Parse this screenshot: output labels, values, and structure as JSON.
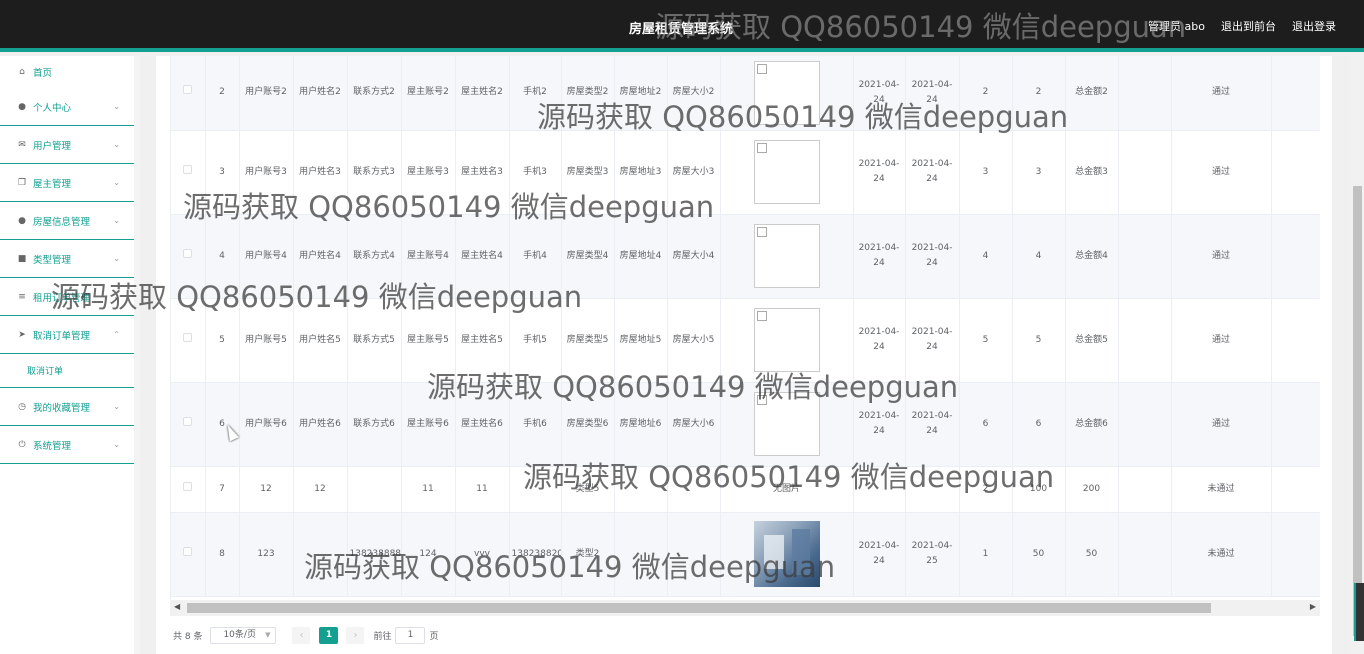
{
  "header": {
    "title": "房屋租赁管理系统",
    "user_label": "管理员 abo",
    "front_link": "退出到前台",
    "logout_link": "退出登录"
  },
  "sidebar": {
    "items": [
      {
        "label": "首页",
        "icon": "home-icon"
      },
      {
        "label": "个人中心",
        "icon": "user-icon"
      },
      {
        "label": "用户管理",
        "icon": "mail-icon"
      },
      {
        "label": "屋主管理",
        "icon": "copy-icon"
      },
      {
        "label": "房屋信息管理",
        "icon": "user-icon"
      },
      {
        "label": "类型管理",
        "icon": "briefcase-icon"
      },
      {
        "label": "租用订单管理",
        "icon": "sliders-icon"
      },
      {
        "label": "取消订单管理",
        "icon": "send-icon"
      },
      {
        "label": "我的收藏管理",
        "icon": "clock-icon"
      },
      {
        "label": "系统管理",
        "icon": "power-icon"
      }
    ],
    "submenu_label": "取消订单"
  },
  "table": {
    "rows": [
      {
        "id": "2",
        "c1": "用户账号2",
        "c2": "用户姓名2",
        "c3": "联系方式2",
        "c4": "屋主账号2",
        "c5": "屋主姓名2",
        "c6": "手机2",
        "c7": "房屋类型2",
        "c8": "房屋地址2",
        "c9": "房屋大小2",
        "img": "broken",
        "d1": "2021-04-24",
        "d2": "2021-04-24",
        "n1": "2",
        "n2": "2",
        "total": "总金额2",
        "status": "通过"
      },
      {
        "id": "3",
        "c1": "用户账号3",
        "c2": "用户姓名3",
        "c3": "联系方式3",
        "c4": "屋主账号3",
        "c5": "屋主姓名3",
        "c6": "手机3",
        "c7": "房屋类型3",
        "c8": "房屋地址3",
        "c9": "房屋大小3",
        "img": "broken",
        "d1": "2021-04-24",
        "d2": "2021-04-24",
        "n1": "3",
        "n2": "3",
        "total": "总金额3",
        "status": "通过"
      },
      {
        "id": "4",
        "c1": "用户账号4",
        "c2": "用户姓名4",
        "c3": "联系方式4",
        "c4": "屋主账号4",
        "c5": "屋主姓名4",
        "c6": "手机4",
        "c7": "房屋类型4",
        "c8": "房屋地址4",
        "c9": "房屋大小4",
        "img": "broken",
        "d1": "2021-04-24",
        "d2": "2021-04-24",
        "n1": "4",
        "n2": "4",
        "total": "总金额4",
        "status": "通过"
      },
      {
        "id": "5",
        "c1": "用户账号5",
        "c2": "用户姓名5",
        "c3": "联系方式5",
        "c4": "屋主账号5",
        "c5": "屋主姓名5",
        "c6": "手机5",
        "c7": "房屋类型5",
        "c8": "房屋地址5",
        "c9": "房屋大小5",
        "img": "broken",
        "d1": "2021-04-24",
        "d2": "2021-04-24",
        "n1": "5",
        "n2": "5",
        "total": "总金额5",
        "status": "通过"
      },
      {
        "id": "6",
        "c1": "用户账号6",
        "c2": "用户姓名6",
        "c3": "联系方式6",
        "c4": "屋主账号6",
        "c5": "屋主姓名6",
        "c6": "手机6",
        "c7": "房屋类型6",
        "c8": "房屋地址6",
        "c9": "房屋大小6",
        "img": "broken",
        "d1": "2021-04-24",
        "d2": "2021-04-24",
        "n1": "6",
        "n2": "6",
        "total": "总金额6",
        "status": "通过"
      },
      {
        "id": "7",
        "c1": "12",
        "c2": "12",
        "c3": "",
        "c4": "11",
        "c5": "11",
        "c6": "",
        "c7": "类型5",
        "c8": "",
        "c9": "",
        "img": "text",
        "img_text": "无图片",
        "d1": "",
        "d2": "",
        "n1": "2",
        "n2": "100",
        "total": "200",
        "status": "未通过"
      },
      {
        "id": "8",
        "c1": "123",
        "c2": "",
        "c3": "13823888888",
        "c4": "124",
        "c5": "vvv",
        "c6": "13823882032",
        "c7": "类型2",
        "c8": "",
        "c9": "",
        "img": "photo",
        "d1": "2021-04-24",
        "d2": "2021-04-25",
        "n1": "1",
        "n2": "50",
        "total": "50",
        "status": "未通过"
      }
    ],
    "op_icon": "edit-icon"
  },
  "pagination": {
    "total_label": "共 8 条",
    "page_size": "10条/页",
    "current_page": "1",
    "goto_label": "前往",
    "goto_value": "1",
    "page_suffix": "页"
  },
  "watermarks": [
    "源码获取 QQ86050149 微信deepguan",
    "源码获取 QQ86050149 微信deepguan",
    "源码获取 QQ86050149 微信deepguan",
    "源码获取 QQ86050149 微信deepguan",
    "源码获取 QQ86050149 微信deepguan",
    "源码获取 QQ86050149 微信deepguan",
    "源码获取 QQ86050149 微信deepguan"
  ],
  "colors": {
    "accent": "#13a091",
    "topbar": "#1d1d1d"
  }
}
